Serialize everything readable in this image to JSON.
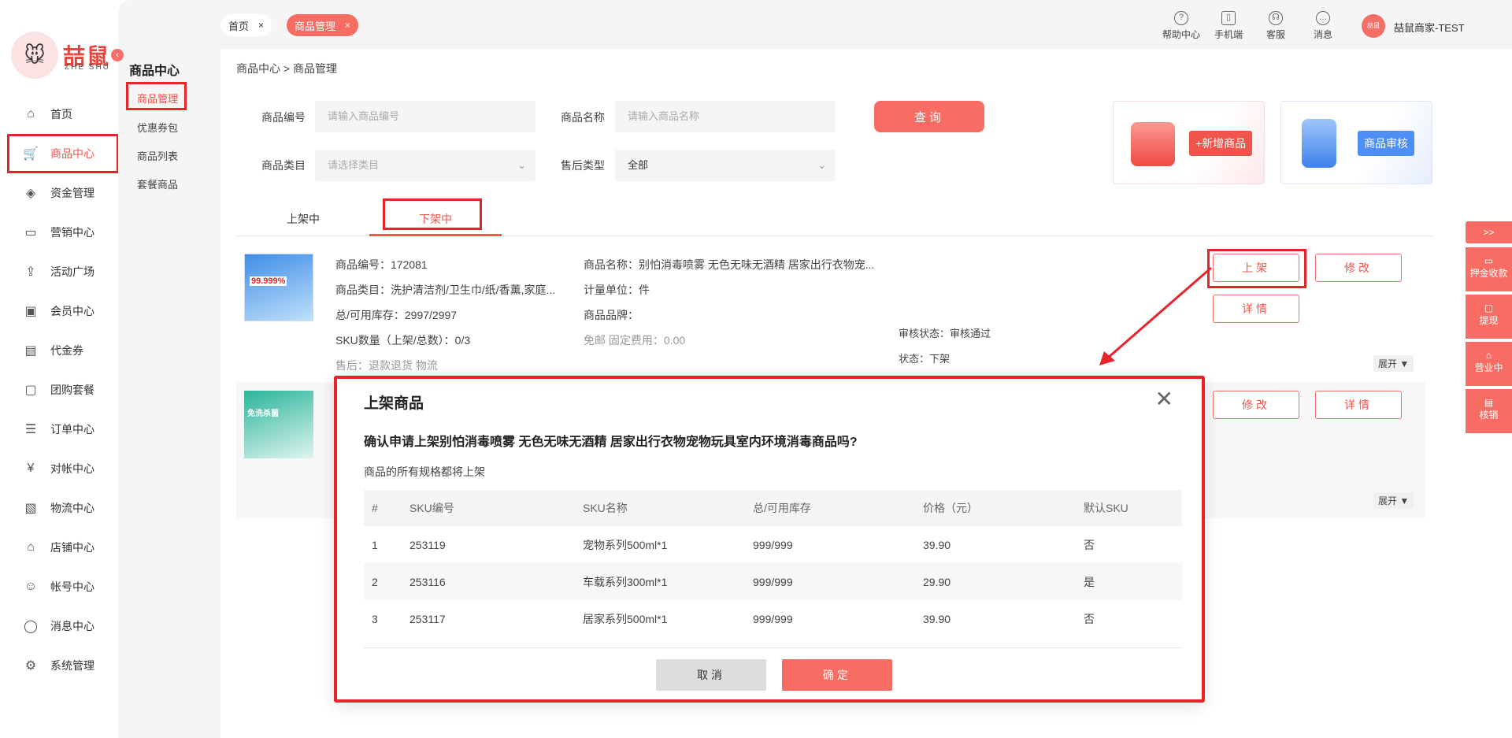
{
  "brand": {
    "logo_text": "喆鼠",
    "logo_sub": "ZHE SHU"
  },
  "leftnav": [
    {
      "label": "首页",
      "icon": "home-icon"
    },
    {
      "label": "商品中心",
      "icon": "cart-icon"
    },
    {
      "label": "资金管理",
      "icon": "layers-icon"
    },
    {
      "label": "营销中心",
      "icon": "screen-icon"
    },
    {
      "label": "活动广场",
      "icon": "upload-box-icon"
    },
    {
      "label": "会员中心",
      "icon": "vip-icon"
    },
    {
      "label": "代金券",
      "icon": "voucher-icon"
    },
    {
      "label": "团购套餐",
      "icon": "bag-icon"
    },
    {
      "label": "订单中心",
      "icon": "order-icon"
    },
    {
      "label": "对帐中心",
      "icon": "yen-icon"
    },
    {
      "label": "物流中心",
      "icon": "box-icon"
    },
    {
      "label": "店铺中心",
      "icon": "store-icon"
    },
    {
      "label": "帐号中心",
      "icon": "user-icon"
    },
    {
      "label": "消息中心",
      "icon": "chat-icon"
    },
    {
      "label": "系统管理",
      "icon": "settings-icon"
    }
  ],
  "subnav": {
    "title": "商品中心",
    "items": [
      "商品管理",
      "优惠券包",
      "商品列表",
      "套餐商品"
    ]
  },
  "tabs": [
    {
      "label": "首页"
    },
    {
      "label": "商品管理"
    }
  ],
  "top_icons": [
    {
      "label": "帮助中心",
      "glyph": "?"
    },
    {
      "label": "手机端",
      "glyph": "▯"
    },
    {
      "label": "客服",
      "glyph": "☊"
    },
    {
      "label": "消息",
      "glyph": "…"
    }
  ],
  "user": {
    "name": "喆鼠商家-TEST",
    "avatar_text": "喆鼠"
  },
  "breadcrumb": {
    "parent": "商品中心",
    "sep": ">",
    "current": "商品管理"
  },
  "filters": {
    "code_label": "商品编号",
    "code_placeholder": "请输入商品编号",
    "name_label": "商品名称",
    "name_placeholder": "请输入商品名称",
    "category_label": "商品类目",
    "category_placeholder": "请选择类目",
    "aftersale_label": "售后类型",
    "aftersale_value": "全部",
    "query_label": "查询"
  },
  "cards": {
    "add_label": "+新增商品",
    "review_label": "商品审核"
  },
  "product_tabs": [
    "上架中",
    "下架中"
  ],
  "product": {
    "code": "商品编号：172081",
    "category": "商品类目：洗护清洁剂/卫生巾/纸/香薰,家庭...",
    "stock": "总/可用库存：2997/2997",
    "sku_count": "SKU数量（上架/总数）：0/3",
    "aftersale": "售后：退款退货  物流",
    "name": "商品名称：别怕消毒喷雾 无色无味无酒精 居家出行衣物宠...",
    "unit": "计量单位：件",
    "brand": "商品品牌：",
    "shipping": "免邮   固定费用：0.00",
    "audit": "审核状态：审核通过",
    "status": "状态：下架",
    "thumb_text": "99.999%",
    "btn_up": "上架",
    "btn_edit": "修改",
    "btn_detail": "详情",
    "expand": "展开"
  },
  "product2": {
    "thumb_text": "免洗杀菌",
    "btn_edit": "修改",
    "btn_detail": "详情",
    "expand": "展开"
  },
  "right_float": {
    "toggle": ">>",
    "items": [
      "押金收款",
      "提现",
      "营业中",
      "核销"
    ]
  },
  "modal": {
    "title": "上架商品",
    "question": "确认申请上架别怕消毒喷雾 无色无味无酒精 居家出行衣物宠物玩具室内环境消毒商品吗?",
    "note": "商品的所有规格都将上架",
    "columns": [
      "#",
      "SKU编号",
      "SKU名称",
      "总/可用库存",
      "价格（元）",
      "默认SKU"
    ],
    "rows": [
      [
        "1",
        "253119",
        "宠物系列500ml*1",
        "999/999",
        "39.90",
        "否"
      ],
      [
        "2",
        "253116",
        "车载系列300ml*1",
        "999/999",
        "29.90",
        "是"
      ],
      [
        "3",
        "253117",
        "居家系列500ml*1",
        "999/999",
        "39.90",
        "否"
      ]
    ],
    "cancel": "取消",
    "confirm": "确定"
  },
  "colors": {
    "accent": "#f0544b",
    "highlight": "#e8232a",
    "button": "#f86d63",
    "blue_button": "#4d8ff5"
  }
}
